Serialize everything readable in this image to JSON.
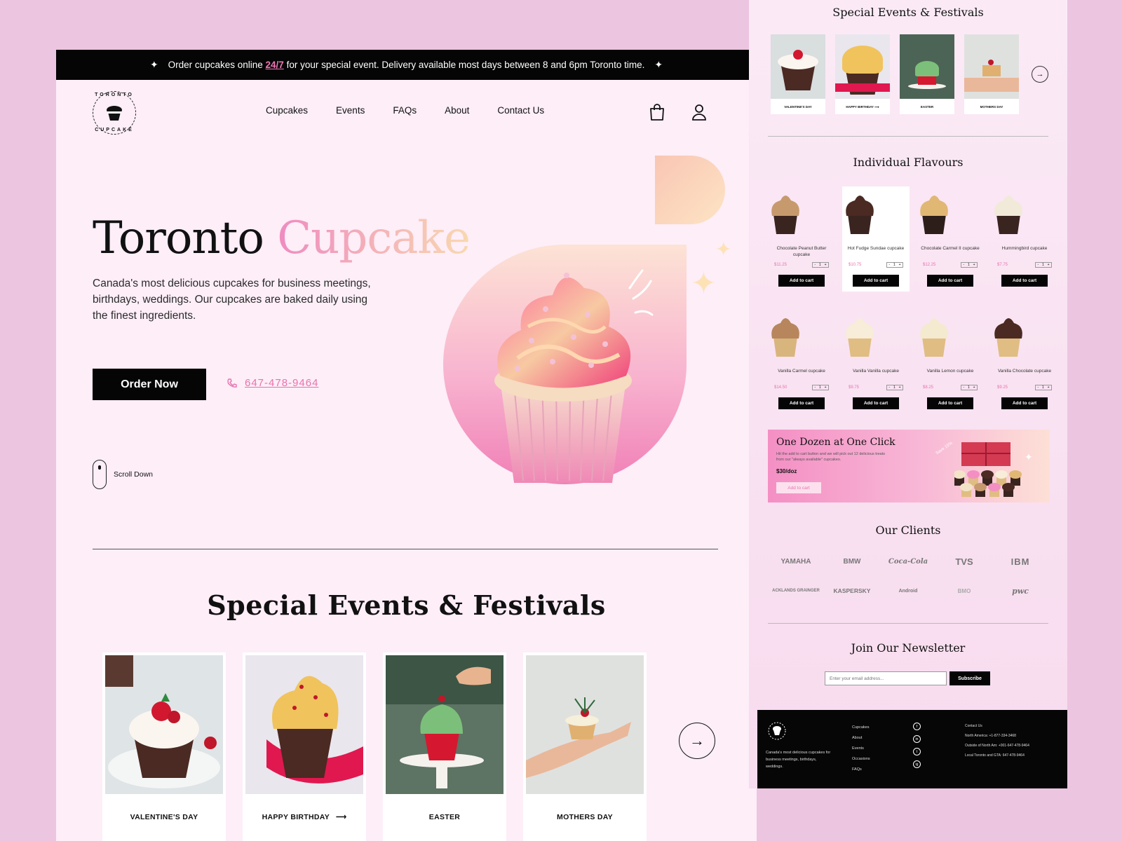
{
  "announcement": {
    "prefix": "Order cupcakes online",
    "highlight": "24/7",
    "suffix": "for your special event. Delivery available most days between 8 and 6pm Toronto time."
  },
  "logo": {
    "top_text": "TORONTO",
    "bottom_text": "CUPCAKE"
  },
  "nav": {
    "items": [
      "Cupcakes",
      "Events",
      "FAQs",
      "About",
      "Contact Us"
    ]
  },
  "hero": {
    "title_main": "Toronto",
    "title_accent": "Cupcake",
    "description": "Canada's most delicious cupcakes for business meetings, birthdays, weddings. Our cupcakes are baked daily using the finest ingredients.",
    "order_label": "Order Now",
    "phone": "647-478-9464",
    "scroll_label": "Scroll Down"
  },
  "events": {
    "title": "Special Events & Festivals",
    "items": [
      {
        "label": "VALENTINE'S DAY"
      },
      {
        "label": "HAPPY BIRTHDAY",
        "arrow": "⟶"
      },
      {
        "label": "EASTER"
      },
      {
        "label": "MOTHERS DAY"
      }
    ],
    "next_icon": "→"
  },
  "side": {
    "events_title": "Special Events & Festivals",
    "event_labels": [
      "VALENTINE'S DAY",
      "HAPPY BIRTHDAY ⟶",
      "EASTER",
      "MOTHERS DAY"
    ],
    "flavours_title": "Individual Flavours",
    "flavours": [
      {
        "name": "Chocolate Peanut Butter cupcake",
        "price": "$11.25",
        "cup": "#3a2420",
        "top": "#c79a6e"
      },
      {
        "name": "Hot Fudge Sundae cupcake",
        "price": "$10.75",
        "cup": "#3a2420",
        "top": "#4a2a22"
      },
      {
        "name": "Chocolate Carmel II cupcake",
        "price": "$12.25",
        "cup": "#2d1e1a",
        "top": "#e1b774"
      },
      {
        "name": "Hummingbird cupcake",
        "price": "$7.75",
        "cup": "#3a2420",
        "top": "#f2ead8"
      },
      {
        "name": "Vanilla Carmel cupcake",
        "price": "$14.50",
        "cup": "#d9b57e",
        "top": "#b7865d"
      },
      {
        "name": "Vanilla Vanilla cupcake",
        "price": "$9.75",
        "cup": "#e0bd82",
        "top": "#f7edd8"
      },
      {
        "name": "Vanilla Lemon cupcake",
        "price": "$8.25",
        "cup": "#e0bd82",
        "top": "#f4ead0"
      },
      {
        "name": "Vanilla Chocolate cupcake",
        "price": "$9.25",
        "cup": "#e0bd82",
        "top": "#4a2a22"
      }
    ],
    "add_to_cart": "Add to cart",
    "qty": {
      "minus": "-",
      "value": "1",
      "plus": "+"
    },
    "dozen": {
      "title": "One Dozen at One Click",
      "desc": "Hit the add to cart button and we will pick out 12 delicious treats from our \"always available\" cupcakes.",
      "price": "$30/doz",
      "button": "Add to cart",
      "save": "Save 15%"
    },
    "clients_title": "Our Clients",
    "clients": [
      "YAMAHA",
      "BMW",
      "Coca-Cola",
      "TVS",
      "IBM",
      "ACKLANDS GRAINGER",
      "KASPERSKY",
      "Android",
      "BMO",
      "pwc"
    ],
    "newsletter_title": "Join Our Newsletter",
    "newsletter_placeholder": "Enter your email address...",
    "subscribe": "Subscribe",
    "footer": {
      "desc": "Canada's most delicious cupcakes for business meetings, birthdays, weddings.",
      "links": [
        "Cupcakes",
        "About",
        "Events",
        "Occasions",
        "FAQs"
      ],
      "social": [
        "f",
        "in",
        "t",
        "ig"
      ],
      "contact_title": "Contact Us",
      "contact_lines": [
        "North America: +1-877-334-3468",
        "Outside of North Am: +001-647-478-9464",
        "Local Toronto and GTA: 647-478-9464"
      ]
    }
  }
}
